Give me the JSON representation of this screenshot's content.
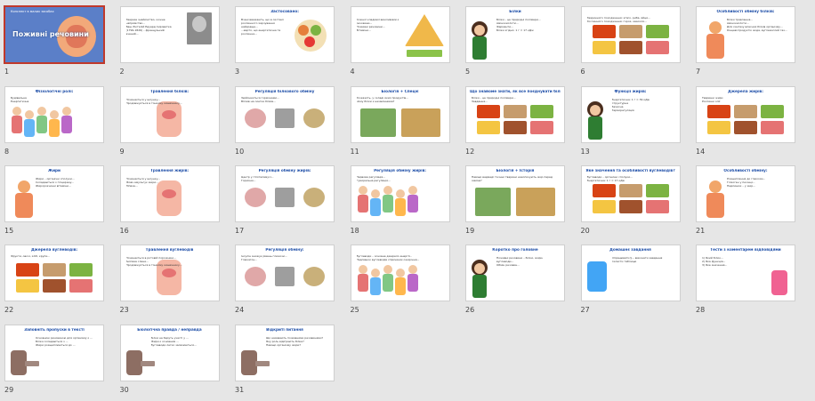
{
  "slides": [
    {
      "n": "1",
      "title": "Поживні речовини",
      "subtitle": "Конспект в малих засобах",
      "kind": "cover"
    },
    {
      "n": "2",
      "title": "",
      "lines": [
        "Тверезе знайомство, кожне напрямство...",
        "Ваш Лікталій Едуард Сироватка (1799-1826) – французький вчений..."
      ],
      "kind": "portrait"
    },
    {
      "n": "3",
      "title": "Застосовано:",
      "lines": [
        "Вчені вважають, що в системі рослинного харчування найкраще...",
        "...варто, що енергетична та рослинна..."
      ],
      "kind": "food-plate"
    },
    {
      "n": "4",
      "title": "",
      "lines": [
        "Кожної кладової важливими є речовини...",
        "Поживні речовини...",
        "Вітаміни..."
      ],
      "kind": "pyramid"
    },
    {
      "n": "5",
      "title": "Білки",
      "lines": [
        "Білки – це природні полімери...",
        "Амінокислоти...",
        "Ферменти...",
        "Білки згідно: 1 г = 17 кДж"
      ],
      "kind": "teacher"
    },
    {
      "n": "6",
      "title": "",
      "lines": [
        "Тваринного походження: м'ясо, риба, яйця...",
        "Рослинного походження: горох, квасоля..."
      ],
      "kind": "food-grid"
    },
    {
      "n": "7",
      "title": "Особливості обміну білків:",
      "lines": [
        "Білки травлення...",
        "Амінокислоти...",
        "Для синтезу власних білків організму...",
        "Кінцеві продукти: вода, вуглекислий газ..."
      ],
      "kind": "body"
    },
    {
      "n": "8",
      "title": "Фізіологічні ролі:",
      "lines": [
        "Будівельна",
        "Енергетична"
      ],
      "kind": "people"
    },
    {
      "n": "9",
      "title": "Травлення білків:",
      "lines": [
        "Починається у шлунку...",
        "Продовжується в тонкому кишечнику..."
      ],
      "kind": "digest"
    },
    {
      "n": "10",
      "title": "Регуляція білкового обміну",
      "lines": [
        "Здійснюється гормонами...",
        "Вплив на синтез білків..."
      ],
      "kind": "regulation"
    },
    {
      "n": "11",
      "title": "Біологія + Спеціє",
      "lines": [
        "Розкажіть, у складі яких продуктів...",
        "Чому білки є незамінними?"
      ],
      "kind": "plants"
    },
    {
      "n": "12",
      "title": "Що знайоме знати, як все поєднувати білкового обміну?",
      "lines": [
        "Білки – це природні полімери...",
        "Завдання..."
      ],
      "kind": "food-grid"
    },
    {
      "n": "13",
      "title": "Функції жирів:",
      "lines": [
        "Енергетична: 1 г = 39 кДж",
        "Структурна",
        "Захисна",
        "Терморегуляція"
      ],
      "kind": "teacher"
    },
    {
      "n": "14",
      "title": "Джерела жирів:",
      "lines": [
        "Тваринні жири",
        "Рослинні олії"
      ],
      "kind": "food-grid"
    },
    {
      "n": "15",
      "title": "Жири",
      "lines": [
        "Жири – органічні сполуки...",
        "Складаються з гліцерину...",
        "Жиророзчинні вітаміни..."
      ],
      "kind": "body"
    },
    {
      "n": "16",
      "title": "Травлення жирів:",
      "lines": [
        "Починається у шлунку...",
        "Жовч емульгує жири...",
        "Ліпаза..."
      ],
      "kind": "digest"
    },
    {
      "n": "17",
      "title": "Регуляція обміну жирів:",
      "lines": [
        "Центр у гіпоталамусі...",
        "Гормони..."
      ],
      "kind": "regulation"
    },
    {
      "n": "18",
      "title": "Регуляція обміну жирів:",
      "lines": [
        "Нервова регуляція...",
        "Гуморальна регуляція..."
      ],
      "kind": "people"
    },
    {
      "n": "19",
      "title": "Біологія + Історія",
      "lines": [
        "Навіщо ведмеді та інші тварини накопичують жир перед зимою?"
      ],
      "kind": "plants"
    },
    {
      "n": "20",
      "title": "Яке значення та особливості вуглеводів?",
      "lines": [
        "Вуглеводи – органічні сполуки...",
        "Енергетична: 1 г = 17 кДж"
      ],
      "kind": "food-grid"
    },
    {
      "n": "21",
      "title": "Особливості обміну:",
      "lines": [
        "Розщеплення до глюкози...",
        "Глікоген у печінці...",
        "Надлишок – у жир..."
      ],
      "kind": "body"
    },
    {
      "n": "22",
      "title": "Джерела вуглеводів:",
      "lines": [
        "Фрукти, овочі, хліб, крупи..."
      ],
      "kind": "food-grid"
    },
    {
      "n": "23",
      "title": "Травлення вуглеводів",
      "lines": [
        "Починається в ротовій порожнині...",
        "Амілаза слини...",
        "Продовжується в тонкому кишечнику..."
      ],
      "kind": "digest"
    },
    {
      "n": "24",
      "title": "Регуляція обміну:",
      "lines": [
        "Інсулін знижує рівень глюкози...",
        "Глюкагон..."
      ],
      "kind": "regulation"
    },
    {
      "n": "25",
      "title": "",
      "lines": [
        "Вуглеводи – основне джерело енергії...",
        "Надлишок вуглеводів спричиняє ожиріння..."
      ],
      "kind": "people"
    },
    {
      "n": "26",
      "title": "Коротко про головне",
      "lines": [
        "Поживні речовини – білки, жири, вуглеводи...",
        "Обмін речовин..."
      ],
      "kind": "teacher"
    },
    {
      "n": "27",
      "title": "Домашнє завдання",
      "lines": [
        "Опрацювати §.., виконати завдання",
        "Скласти таблицю"
      ],
      "kind": "homework"
    },
    {
      "n": "28",
      "title": "Тести з коментарем відповідями",
      "lines": [
        "1) Який білок...",
        "2) Яка функція...",
        "3) Яке значення..."
      ],
      "kind": "quiz"
    },
    {
      "n": "29",
      "title": "Заповніть пропуски в тексті",
      "lines": [
        "Основною речовиною для організму є ...",
        "Білки складаються з ...",
        "Жири розщеплюються до ..."
      ],
      "kind": "student"
    },
    {
      "n": "30",
      "title": "Біологічна правда / неправда",
      "lines": [
        "Білки не беруть участі у ...",
        "Жири є основним ...",
        "Вуглеводи легко засвоюються..."
      ],
      "kind": "student"
    },
    {
      "n": "31",
      "title": "Відкриті питання",
      "lines": [
        "Що називають поживними речовинами?",
        "Яку роль відіграють білки?",
        "Навіщо організму жири?"
      ],
      "kind": "student"
    }
  ],
  "colors": {
    "accent": "#1f4fa8",
    "selection": "#c0392b",
    "background": "#e6e6e6",
    "cover": "#5b7fc8"
  }
}
